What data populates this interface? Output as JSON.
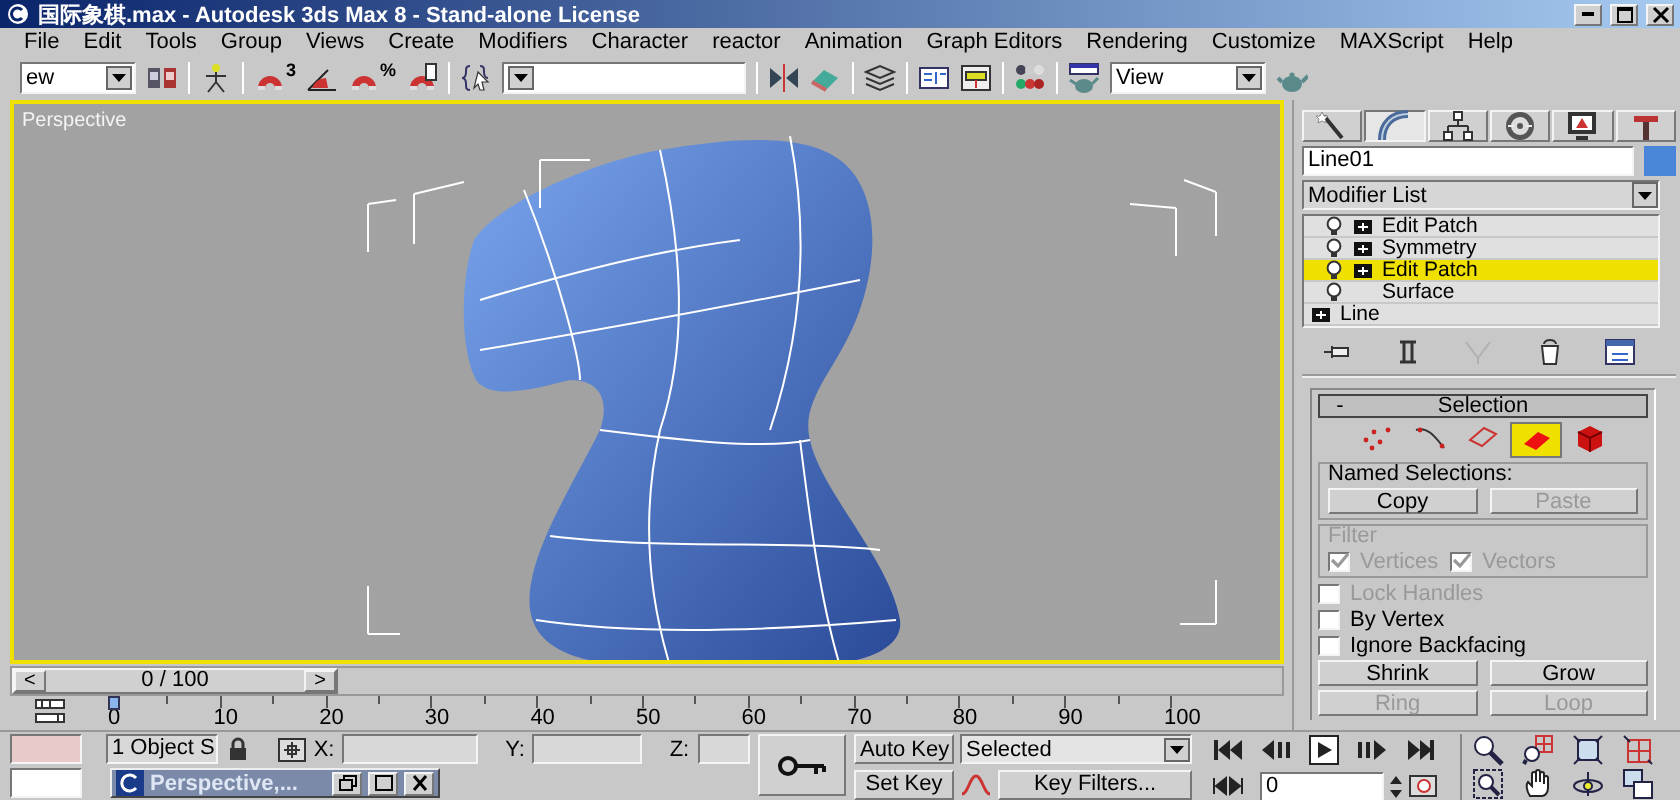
{
  "window": {
    "title": "国际象棋.max - Autodesk 3ds Max 8  - Stand-alone License"
  },
  "menu": [
    "File",
    "Edit",
    "Tools",
    "Group",
    "Views",
    "Create",
    "Modifiers",
    "Character",
    "reactor",
    "Animation",
    "Graph Editors",
    "Rendering",
    "Customize",
    "MAXScript",
    "Help"
  ],
  "toolbar": [
    {
      "kind": "dropdown",
      "value": "ew"
    },
    {
      "kind": "windows"
    },
    {
      "kind": "sep"
    },
    {
      "kind": "figure"
    },
    {
      "kind": "sep"
    },
    {
      "kind": "magnet",
      "text": "3"
    },
    {
      "kind": "angle"
    },
    {
      "kind": "magnet",
      "text": "%"
    },
    {
      "kind": "spinner-magnet"
    },
    {
      "kind": "sep"
    },
    {
      "kind": "braces"
    },
    {
      "kind": "named"
    },
    {
      "kind": "sep"
    },
    {
      "kind": "mirror"
    },
    {
      "kind": "align"
    },
    {
      "kind": "sep"
    },
    {
      "kind": "layers"
    },
    {
      "kind": "sep"
    },
    {
      "kind": "curves"
    },
    {
      "kind": "schematic"
    },
    {
      "kind": "sep"
    },
    {
      "kind": "materials"
    },
    {
      "kind": "sep"
    },
    {
      "kind": "render-setup"
    },
    {
      "kind": "dropdown",
      "value": "View"
    },
    {
      "kind": "teapot"
    }
  ],
  "viewport": {
    "label": "Perspective",
    "active": true
  },
  "command_panel": {
    "tabs": [
      {
        "kind": "create",
        "selected": false
      },
      {
        "kind": "modify",
        "selected": true
      },
      {
        "kind": "hierarchy",
        "selected": false
      },
      {
        "kind": "motion",
        "selected": false
      },
      {
        "kind": "display",
        "selected": false
      },
      {
        "kind": "utilities",
        "selected": false
      }
    ],
    "object": {
      "name": "Line01",
      "color": "#4a86d8"
    },
    "modifier_list": "Modifier List",
    "stack": [
      {
        "label": "Edit Patch",
        "kind": "modifier",
        "selected": false
      },
      {
        "label": "Symmetry",
        "kind": "modifier",
        "selected": false
      },
      {
        "label": "Edit Patch",
        "kind": "modifier",
        "selected": true,
        "children": [
          {
            "label": "Surface",
            "kind": "sub-object",
            "selected": false
          }
        ]
      },
      {
        "label": "Line",
        "kind": "base",
        "selected": false
      }
    ],
    "stack_tools": [
      {
        "kind": "pin",
        "disabled": false
      },
      {
        "kind": "show-end",
        "disabled": false
      },
      {
        "kind": "make-unique",
        "disabled": true
      },
      {
        "kind": "remove",
        "disabled": false
      },
      {
        "kind": "configure",
        "disabled": false
      }
    ],
    "rollout": {
      "title": "Selection",
      "collapse": "-",
      "levels": [
        {
          "kind": "vertex",
          "selected": false
        },
        {
          "kind": "handle",
          "selected": false
        },
        {
          "kind": "edge",
          "selected": false
        },
        {
          "kind": "patch",
          "selected": true
        },
        {
          "kind": "element",
          "selected": false
        }
      ],
      "named_selections": {
        "label": "Named Selections:",
        "buttons": [
          {
            "label": "Copy",
            "disabled": false
          },
          {
            "label": "Paste",
            "disabled": true
          }
        ]
      },
      "filter": {
        "label": "Filter",
        "disabled": true,
        "options": [
          {
            "label": "Vertices",
            "checked": true
          },
          {
            "label": "Vectors",
            "checked": true
          }
        ]
      },
      "checkboxes": [
        {
          "label": "Lock Handles",
          "checked": false,
          "disabled": true
        },
        {
          "label": "By Vertex",
          "checked": false,
          "disabled": false
        },
        {
          "label": "Ignore Backfacing",
          "checked": false,
          "disabled": false
        }
      ],
      "buttons": [
        {
          "label": "Shrink",
          "disabled": false
        },
        {
          "label": "Grow",
          "disabled": false
        },
        {
          "label": "Ring",
          "disabled": true
        },
        {
          "label": "Loop",
          "disabled": true
        }
      ]
    }
  },
  "time_slider": {
    "label": "0 / 100",
    "prev": "<",
    "next": ">",
    "level": 0
  },
  "track": {
    "ticks": [
      "0",
      "10",
      "20",
      "30",
      "40",
      "50",
      "60",
      "70",
      "80",
      "90",
      "100"
    ]
  },
  "status": {
    "selection": "1 Object S",
    "coords": [
      "X:",
      "Y:",
      "Z:"
    ]
  },
  "animation": {
    "auto_key": "Auto Key",
    "set_key": "Set Key",
    "key_set": "Selected",
    "key_filters": "Key Filters...",
    "frame": "0"
  },
  "playback": [
    {
      "kind": "go-start"
    },
    {
      "kind": "prev"
    },
    {
      "kind": "play"
    },
    {
      "kind": "next"
    },
    {
      "kind": "go-end"
    }
  ],
  "nav": [
    {
      "kind": "zoom"
    },
    {
      "kind": "zoom-all"
    },
    {
      "kind": "zoom-extents"
    },
    {
      "kind": "zoom-extents-all"
    },
    {
      "kind": "region-zoom"
    },
    {
      "kind": "pan"
    },
    {
      "kind": "orbit"
    },
    {
      "kind": "maximize"
    }
  ],
  "mini_window": {
    "title": "Perspective,..."
  }
}
